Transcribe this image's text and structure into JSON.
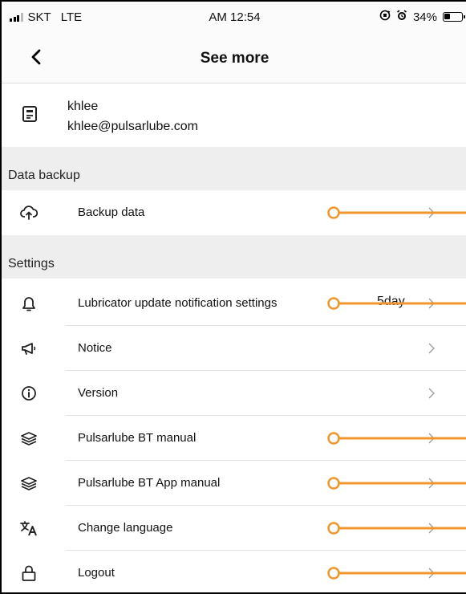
{
  "status_bar": {
    "carrier": "SKT",
    "network": "LTE",
    "time": "AM 12:54",
    "battery_text": "34%",
    "battery_level": 0.34,
    "icons": [
      "signal-icon",
      "orientation-lock-icon",
      "alarm-icon",
      "battery-icon"
    ]
  },
  "nav": {
    "title": "See more",
    "back_icon": "chevron-left-icon"
  },
  "profile": {
    "name": "khlee",
    "email": "khlee@pulsarlube.com",
    "icon": "account-card-icon"
  },
  "sections": [
    {
      "header": "Data backup",
      "items": [
        {
          "label": "Backup data",
          "icon": "cloud-upload-icon",
          "value": "",
          "highlighted": true
        }
      ]
    },
    {
      "header": "Settings",
      "items": [
        {
          "label": "Lubricator update notification settings",
          "icon": "bell-icon",
          "value": "5day",
          "highlighted": true
        },
        {
          "label": "Notice",
          "icon": "megaphone-icon",
          "value": "",
          "highlighted": false
        },
        {
          "label": "Version",
          "icon": "info-icon",
          "value": "",
          "highlighted": false
        },
        {
          "label": "Pulsarlube BT manual",
          "icon": "stack-icon",
          "value": "",
          "highlighted": true
        },
        {
          "label": "Pulsarlube BT App manual",
          "icon": "stack-icon",
          "value": "",
          "highlighted": true
        },
        {
          "label": "Change language",
          "icon": "translate-icon",
          "value": "",
          "highlighted": true
        },
        {
          "label": "Logout",
          "icon": "lock-icon",
          "value": "",
          "highlighted": true
        }
      ]
    }
  ],
  "colors": {
    "annotation": "#F0962E",
    "section_bg": "#EEEEEE",
    "bar_bg": "#FBFBFB",
    "chevron": "#9A9A9A"
  }
}
